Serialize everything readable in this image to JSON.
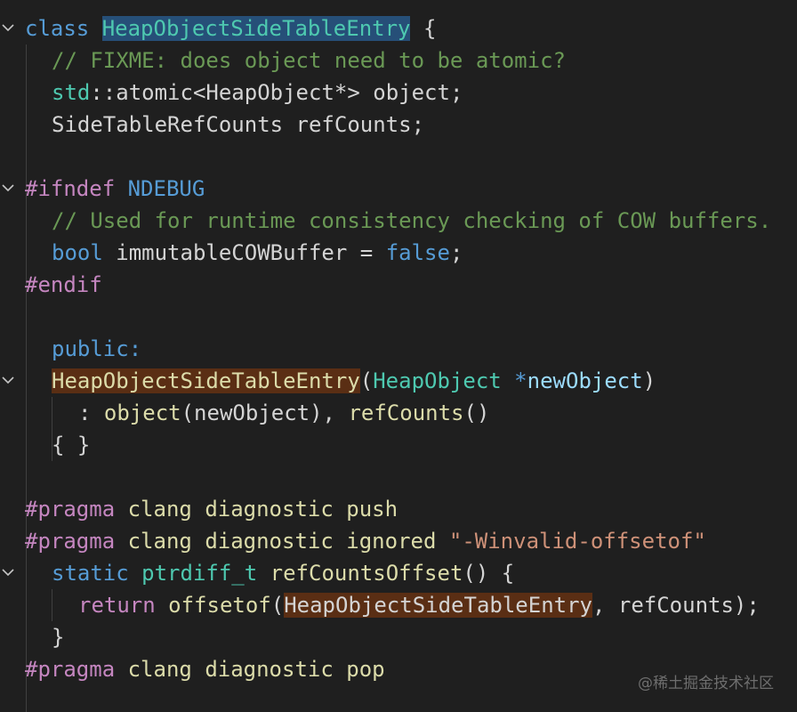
{
  "lines": {
    "l1": {
      "kw": "class",
      "name": "HeapObjectSideTableEntry",
      "brace": "{"
    },
    "l2": {
      "comment": "// FIXME: does object need to be atomic?"
    },
    "l3": {
      "ns": "std",
      "sep": "::atomic<HeapObject*> object;"
    },
    "l4": {
      "text": "SideTableRefCounts refCounts;"
    },
    "l6": {
      "directive": "#ifndef",
      "macro": "NDEBUG"
    },
    "l7": {
      "comment": "// Used for runtime consistency checking of COW buffers."
    },
    "l8": {
      "type": "bool",
      "mid": " immutableCOWBuffer = ",
      "val": "false",
      "end": ";"
    },
    "l9": {
      "directive": "#endif"
    },
    "l11": {
      "kw": "public:"
    },
    "l12": {
      "ctor": "HeapObjectSideTableEntry",
      "open": "(",
      "ptype": "HeapObject",
      "star": " *",
      "param": "newObject",
      "close": ")"
    },
    "l13": {
      "colon": ": ",
      "m1": "object",
      "a1": "(newObject), ",
      "m2": "refCounts",
      "a2": "()"
    },
    "l14": {
      "text": "{ }"
    },
    "l16": {
      "directive": "#pragma",
      "w1": "clang",
      "w2": "diagnostic",
      "w3": "push"
    },
    "l17": {
      "directive": "#pragma",
      "w1": "clang",
      "w2": "diagnostic",
      "w3": "ignored",
      "str": "\"-Winvalid-offsetof\""
    },
    "l18": {
      "kw": "static",
      "type": "ptrdiff_t",
      "fn": "refCountsOffset",
      "rest": "() {"
    },
    "l19": {
      "kw": "return",
      "fn": "offsetof",
      "open": "(",
      "arg": "HeapObjectSideTableEntry",
      "rest": ", refCounts);"
    },
    "l20": {
      "text": "}"
    },
    "l21": {
      "directive": "#pragma",
      "w1": "clang",
      "w2": "diagnostic",
      "w3": "pop"
    }
  },
  "watermark": "@稀土掘金技术社区"
}
